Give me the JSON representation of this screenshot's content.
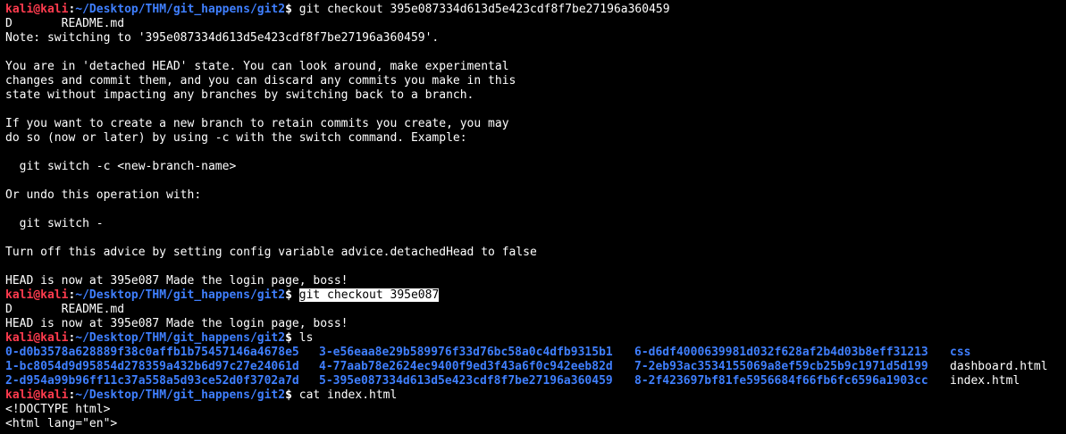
{
  "prompt": {
    "user": "kali@kali",
    "colon": ":",
    "path": "~/Desktop/THM/git_happens/git2",
    "symbol": "$ "
  },
  "lines": {
    "cmd1": "git checkout 395e087334d613d5e423cdf8f7be27196a360459",
    "d1": "D       README.md",
    "note": "Note: switching to '395e087334d613d5e423cdf8f7be27196a360459'.",
    "p1a": "You are in 'detached HEAD' state. You can look around, make experimental",
    "p1b": "changes and commit them, and you can discard any commits you make in this",
    "p1c": "state without impacting any branches by switching back to a branch.",
    "p2a": "If you want to create a new branch to retain commits you create, you may",
    "p2b": "do so (now or later) by using -c with the switch command. Example:",
    "ex1": "  git switch -c <new-branch-name>",
    "undo": "Or undo this operation with:",
    "ex2": "  git switch -",
    "advice": "Turn off this advice by setting config variable advice.detachedHead to false",
    "head1": "HEAD is now at 395e087 Made the login page, boss!",
    "cmd2": "git checkout 395e087",
    "d2": "D       README.md",
    "head2": "HEAD is now at 395e087 Made the login page, boss!",
    "cmd3": "ls",
    "cmd4": "cat index.html",
    "doctype": "<!DOCTYPE html>",
    "htmlopen": "<html lang=\"en\">"
  },
  "ls": {
    "col1": [
      "0-d0b3578a628889f38c0affb1b75457146a4678e5",
      "1-bc8054d9d95854d278359a432b6d97c27e24061d",
      "2-d954a99b96ff11c37a558a5d93ce52d0f3702a7d"
    ],
    "col2": [
      "3-e56eaa8e29b589976f33d76bc58a0c4dfb9315b1",
      "4-77aab78e2624ec9400f9ed3f43a6f0c942eeb82d",
      "5-395e087334d613d5e423cdf8f7be27196a360459"
    ],
    "col3": [
      "6-d6df4000639981d032f628af2b4d03b8eff31213",
      "7-2eb93ac3534155069a8ef59cb25b9c1971d5d199",
      "8-2f423697bf81fe5956684f66fb6fc6596a1903cc"
    ],
    "col4": [
      "css",
      "dashboard.html",
      "index.html"
    ]
  },
  "colors": {
    "background": "#000000",
    "user": "#ff3b4e",
    "path": "#3f7fff",
    "text": "#ffffff"
  }
}
